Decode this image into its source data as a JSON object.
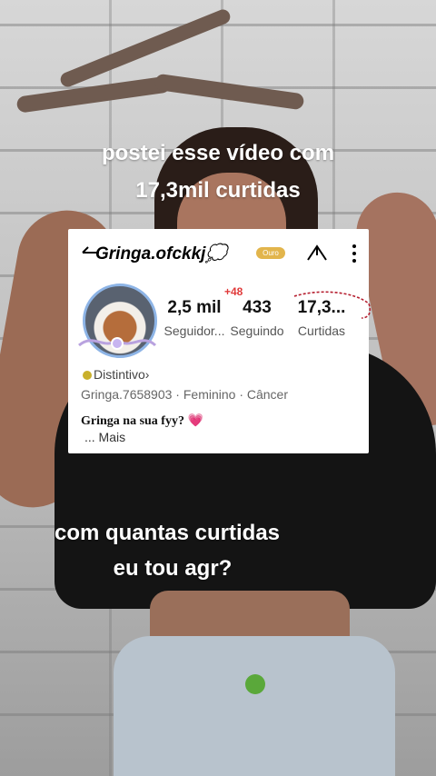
{
  "overlay": {
    "top_line1": "postei esse vídeo com",
    "top_line2": "17,3mil curtidas",
    "bottom_line1": "com quantas curtidas",
    "bottom_line2": "eu tou agr?"
  },
  "profile": {
    "username": "Gringa.ofckkj💭",
    "badge_text": "Ouro",
    "new_followers_badge": "+48",
    "stats": [
      {
        "value": "2,5 mil",
        "label": "Seguidor..."
      },
      {
        "value": "433",
        "label": "Seguindo"
      },
      {
        "value": "17,3...",
        "label": "Curtidas"
      }
    ],
    "distintivo": "Distintivo",
    "distintivo_chevron": "›",
    "meta_line": "Gringa.7658903 · Feminino · Câncer",
    "bio": "Gringa na sua fyy?",
    "bio_emoji": "💗",
    "more_label": "... Mais"
  },
  "icons": [
    "back-icon",
    "share-icon",
    "more-vertical-icon",
    "avatar-image",
    "heart-emoji-icon"
  ],
  "colors": {
    "card_bg": "#ffffff",
    "new_badge": "#e03b3b",
    "badge_gold": "#e2b54c",
    "underline_red": "#b51d2e"
  }
}
